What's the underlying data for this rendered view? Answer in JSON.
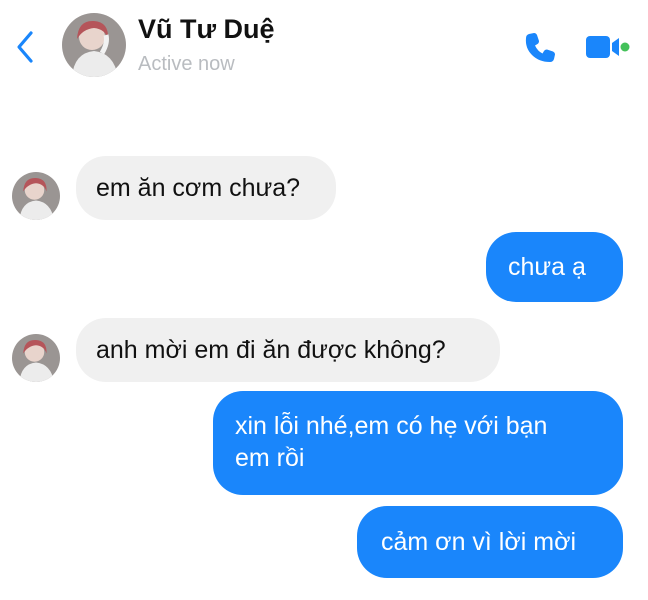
{
  "header": {
    "contact_name": "Vũ Tư Duệ",
    "status": "Active now",
    "back_icon": "chevron-left-icon",
    "call_icon": "phone-icon",
    "video_icon": "video-camera-icon",
    "online_dot_color": "#44c15a"
  },
  "theme": {
    "accent": "#1a86fb",
    "incoming_bubble": "#f0f0f0",
    "status_text": "#b9bcc0"
  },
  "messages": [
    {
      "direction": "incoming",
      "text": "em ăn cơm chưa?"
    },
    {
      "direction": "outgoing",
      "text": "chưa ạ"
    },
    {
      "direction": "incoming",
      "text": "anh mời em đi ăn được không?"
    },
    {
      "direction": "outgoing",
      "text": "xin lỗi nhé,em có hẹ với bạn\nem rồi"
    },
    {
      "direction": "outgoing",
      "text": "cảm ơn vì lời mời"
    }
  ]
}
